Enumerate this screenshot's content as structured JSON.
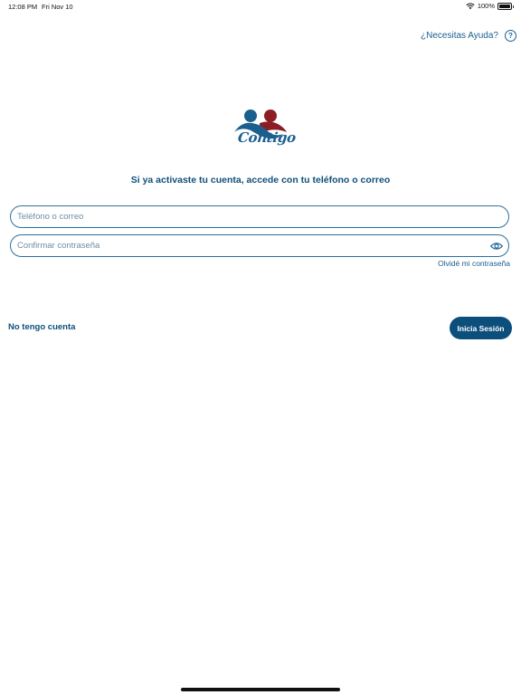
{
  "status_bar": {
    "time": "12:08 PM",
    "date": "Fri Nov 10",
    "battery": "100%"
  },
  "header": {
    "help_link": "¿Necesitas Ayuda?",
    "help_icon_glyph": "?"
  },
  "logo": {
    "text": "Contigo",
    "colors": {
      "blue": "#1b5f8f",
      "red": "#8b1e24"
    }
  },
  "login": {
    "subtitle": "Si ya activaste tu cuenta, accede con tu teléfono o correo",
    "phone_placeholder": "Teléfono o correo",
    "password_placeholder": "Confirmar contraseña",
    "forgot_password": "Olvidé mi contraseña",
    "no_account": "No tengo cuenta",
    "submit_label": "Inicia Sesión"
  },
  "colors": {
    "accent": "#0c4f7c",
    "text": "#0e4f7a",
    "border": "#2f6f9a",
    "background": "#ffffff"
  }
}
